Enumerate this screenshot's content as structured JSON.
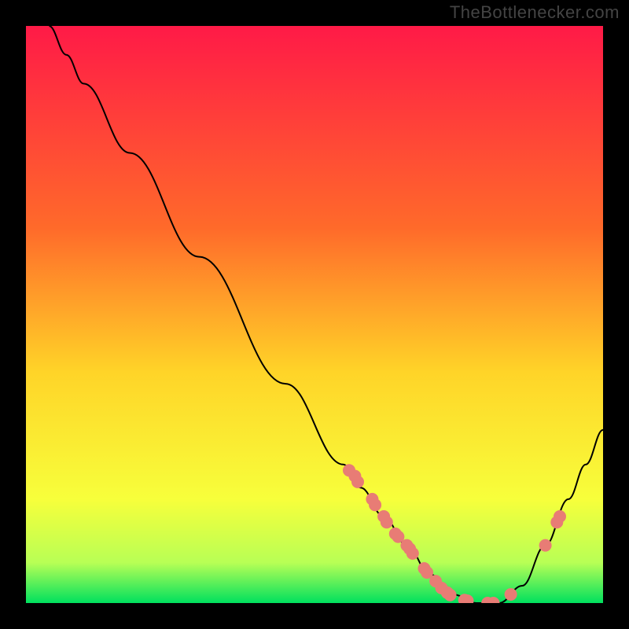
{
  "watermark": "TheBottlenecker.com",
  "colors": {
    "frame": "#000000",
    "line": "#000000",
    "marker": "#e87c75",
    "grad_top": "#ff1a47",
    "grad_upper_mid": "#ff6a2a",
    "grad_mid": "#ffd428",
    "grad_lower_mid": "#f7ff3b",
    "grad_lower": "#b8ff55",
    "grad_bottom": "#00e05e"
  },
  "chart_data": {
    "type": "line",
    "title": "",
    "xlabel": "",
    "ylabel": "",
    "xlim": [
      0,
      100
    ],
    "ylim": [
      0,
      100
    ],
    "curve": [
      {
        "x": 4,
        "y": 100
      },
      {
        "x": 7,
        "y": 95
      },
      {
        "x": 10,
        "y": 90
      },
      {
        "x": 18,
        "y": 78
      },
      {
        "x": 30,
        "y": 60
      },
      {
        "x": 45,
        "y": 38
      },
      {
        "x": 55,
        "y": 24
      },
      {
        "x": 58,
        "y": 20
      },
      {
        "x": 62,
        "y": 15
      },
      {
        "x": 66,
        "y": 10
      },
      {
        "x": 70,
        "y": 5
      },
      {
        "x": 74,
        "y": 1.5
      },
      {
        "x": 78,
        "y": 0
      },
      {
        "x": 82,
        "y": 0
      },
      {
        "x": 86,
        "y": 3
      },
      {
        "x": 90,
        "y": 10
      },
      {
        "x": 94,
        "y": 18
      },
      {
        "x": 97,
        "y": 24
      },
      {
        "x": 100,
        "y": 30
      }
    ],
    "markers": [
      {
        "x": 56,
        "y": 23
      },
      {
        "x": 57,
        "y": 22
      },
      {
        "x": 57.5,
        "y": 21
      },
      {
        "x": 60,
        "y": 18
      },
      {
        "x": 60.5,
        "y": 17
      },
      {
        "x": 62,
        "y": 15
      },
      {
        "x": 62.5,
        "y": 14
      },
      {
        "x": 64,
        "y": 12
      },
      {
        "x": 64.5,
        "y": 11.5
      },
      {
        "x": 66,
        "y": 10
      },
      {
        "x": 66.5,
        "y": 9.4
      },
      {
        "x": 67,
        "y": 8.6
      },
      {
        "x": 69,
        "y": 6
      },
      {
        "x": 69.5,
        "y": 5.3
      },
      {
        "x": 71,
        "y": 3.8
      },
      {
        "x": 72,
        "y": 2.6
      },
      {
        "x": 73,
        "y": 1.8
      },
      {
        "x": 73.5,
        "y": 1.4
      },
      {
        "x": 76,
        "y": 0.5
      },
      {
        "x": 76.5,
        "y": 0.4
      },
      {
        "x": 80,
        "y": 0
      },
      {
        "x": 81,
        "y": 0
      },
      {
        "x": 84,
        "y": 1.5
      },
      {
        "x": 90,
        "y": 10
      },
      {
        "x": 92,
        "y": 14
      },
      {
        "x": 92.5,
        "y": 15
      }
    ]
  }
}
